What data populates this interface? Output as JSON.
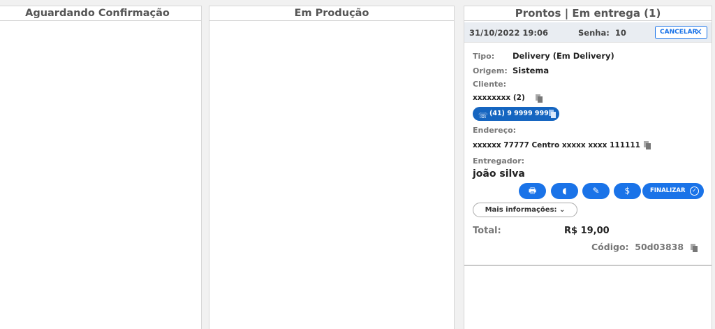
{
  "columns": {
    "waiting": {
      "title": "Aguardando Confirmação"
    },
    "production": {
      "title": "Em Produção"
    },
    "ready": {
      "title": "Prontos | Em entrega (1)"
    }
  },
  "order": {
    "datetime": "31/10/2022 19:06",
    "senha_label": "Senha:",
    "senha_value": "10",
    "cancel_label": "CANCELAR",
    "tipo_label": "Tipo:",
    "tipo_value": "Delivery (Em Delivery)",
    "origem_label": "Origem:",
    "origem_value": "Sistema",
    "cliente_label": "Cliente:",
    "cliente_value": "xxxxxxxx (2)",
    "phone": "(41) 9 9999 9999",
    "endereco_label": "Endereço:",
    "endereco_value": "xxxxxx 77777 Centro xxxxx xxxx 111111",
    "entregador_label": "Entregador:",
    "entregador_value": "joão silva",
    "finalizar_label": "FINALIZAR",
    "mais_label": "Mais informações: ⌄",
    "total_label": "Total:",
    "total_value": "R$ 19,00",
    "codigo_label": "Código:",
    "codigo_value": "50d03838"
  },
  "icons": {
    "print": "printer-icon",
    "payment": "wallet-icon",
    "edit": "pencil-icon",
    "money": "dollar-icon",
    "copy": "copy-icon",
    "phone": "phone-icon",
    "close": "close-icon",
    "check": "check-circle-icon"
  },
  "colors": {
    "accent": "#1a73e8",
    "phone_bg": "#1565c0",
    "card_header": "#e9edf2"
  }
}
